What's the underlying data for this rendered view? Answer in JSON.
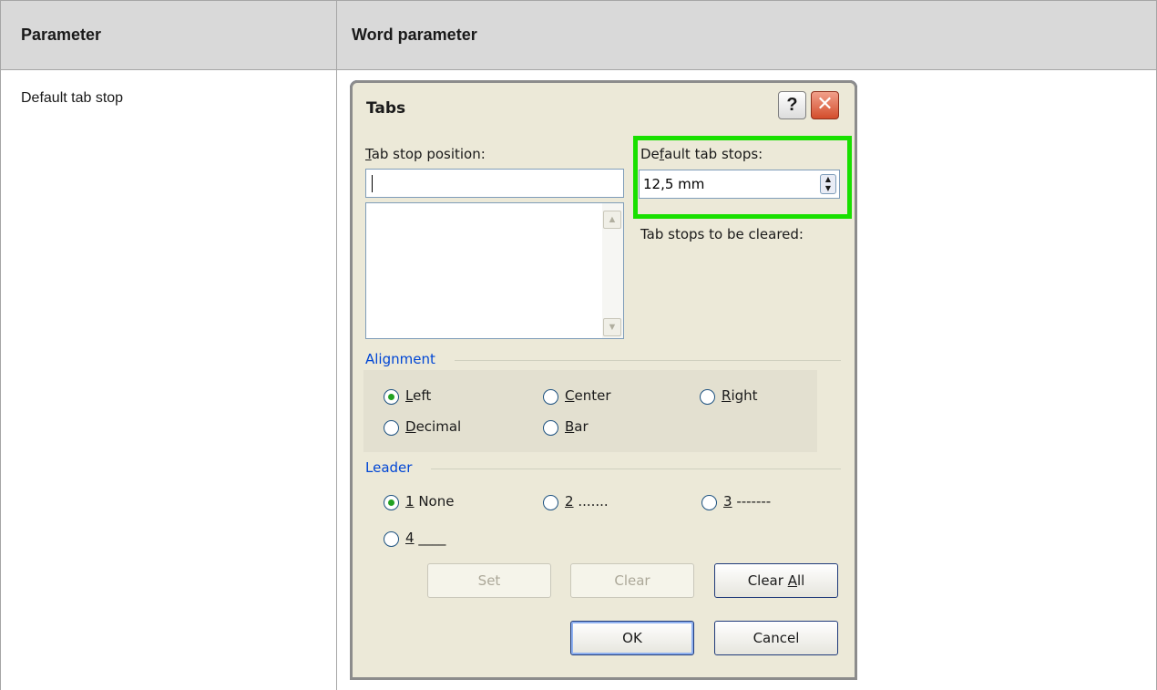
{
  "table": {
    "header": {
      "col1": "Parameter",
      "col2": "Word parameter"
    },
    "row": {
      "parameter": "Default tab stop"
    }
  },
  "dialog": {
    "title": "Tabs",
    "help_glyph": "?",
    "close_glyph": "✕",
    "tab_stop_position": {
      "label_u": "T",
      "label_rest": "ab stop position:",
      "value": ""
    },
    "default_tab_stops": {
      "label_a": "De",
      "label_u": "f",
      "label_b": "ault tab stops:",
      "value": "12,5 mm"
    },
    "tab_stops_cleared_label": "Tab stops to be cleared:",
    "alignment": {
      "title": "Alignment",
      "options": [
        {
          "u": "L",
          "rest": "eft",
          "selected": true
        },
        {
          "u": "C",
          "rest": "enter",
          "selected": false
        },
        {
          "u": "R",
          "rest": "ight",
          "selected": false
        },
        {
          "u": "D",
          "rest": "ecimal",
          "selected": false
        },
        {
          "u": "B",
          "rest": "ar",
          "selected": false
        }
      ]
    },
    "leader": {
      "title": "Leader",
      "options": [
        {
          "u": "1",
          "rest": " None",
          "selected": true
        },
        {
          "u": "2",
          "rest": " .......",
          "selected": false
        },
        {
          "u": "3",
          "rest": " -------",
          "selected": false
        },
        {
          "u": "4",
          "rest": " ____",
          "selected": false
        }
      ]
    },
    "buttons": {
      "set": "Set",
      "clear": "Clear",
      "clear_all_a": "Clear ",
      "clear_all_u": "A",
      "clear_all_b": "ll",
      "ok": "OK",
      "cancel": "Cancel"
    }
  },
  "colors": {
    "highlight": "#19e000",
    "group_title": "#0046d5",
    "header_bg": "#d9d9d9"
  }
}
